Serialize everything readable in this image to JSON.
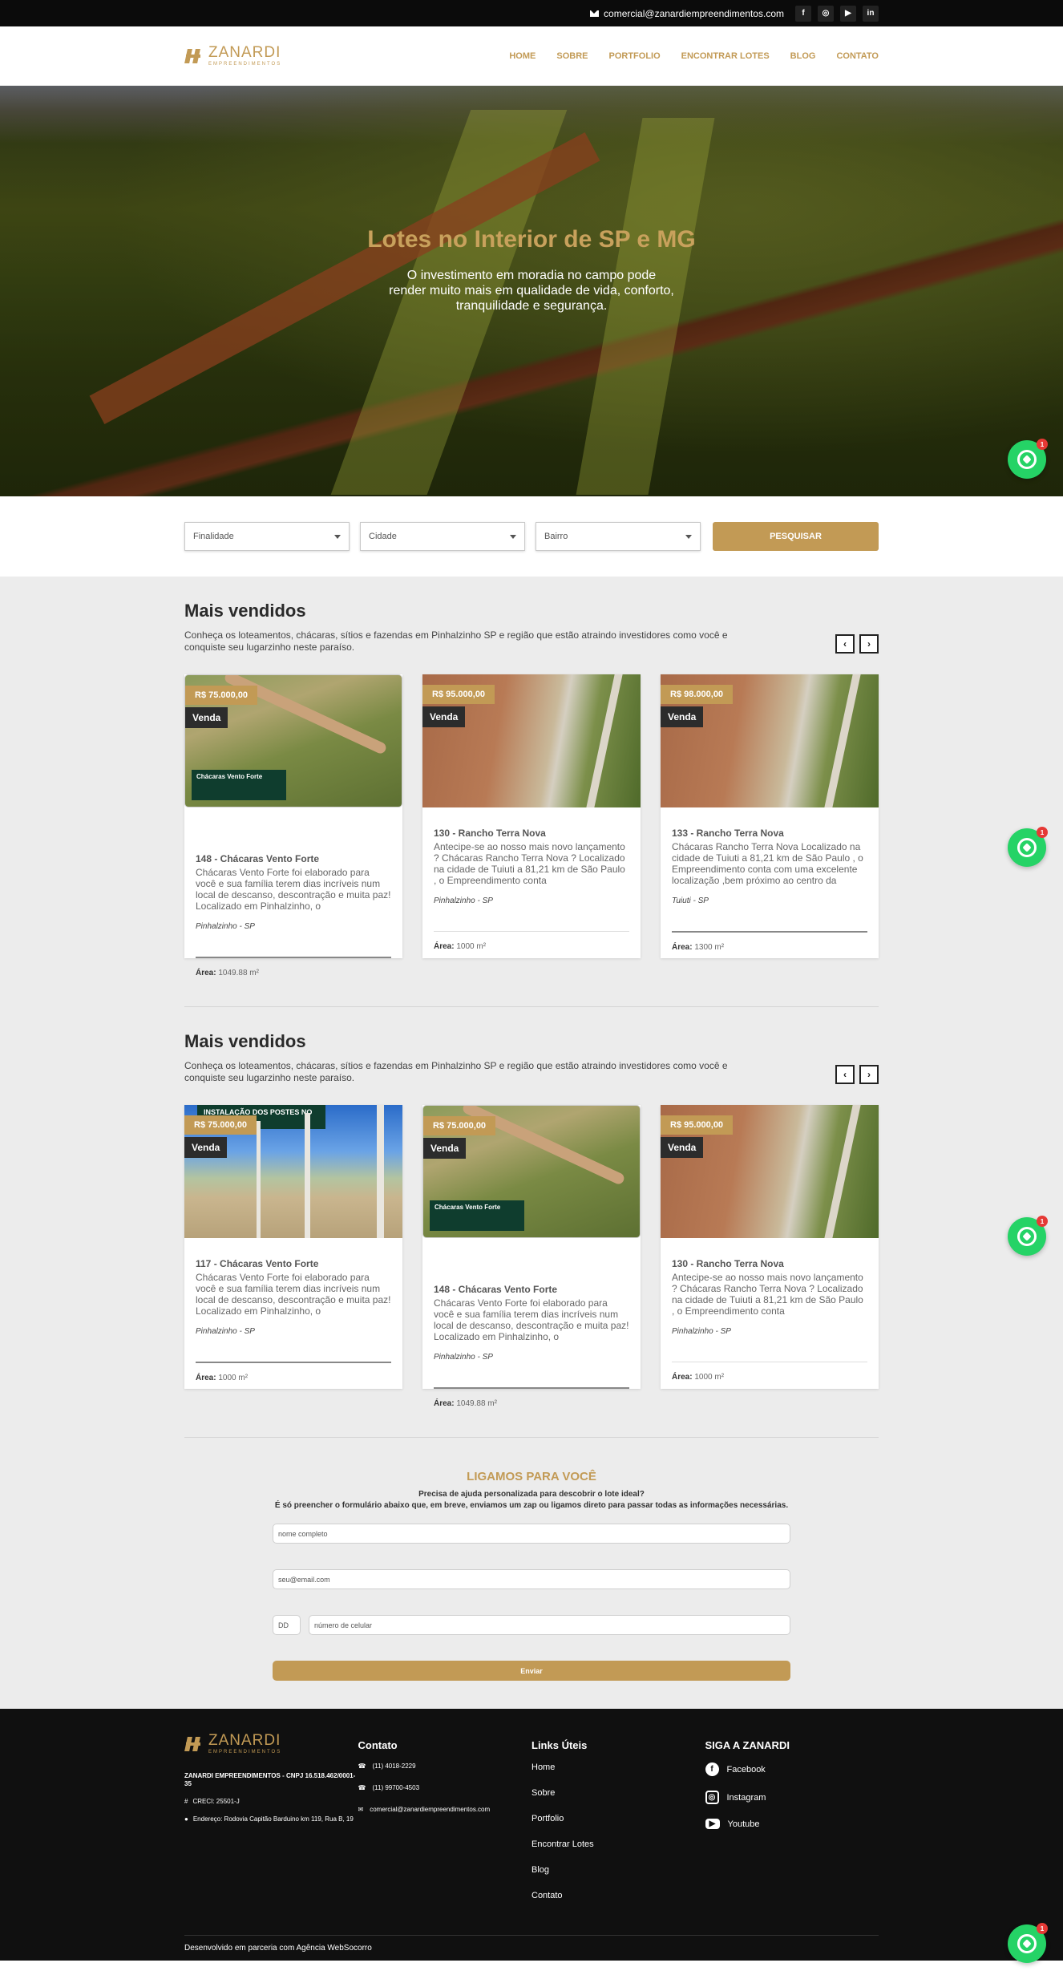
{
  "topbar": {
    "email": "comercial@zanardiempreendimentos.com",
    "social": [
      {
        "icon": "facebook-icon",
        "glyph": "f"
      },
      {
        "icon": "instagram-icon",
        "glyph": "◎"
      },
      {
        "icon": "youtube-icon",
        "glyph": "▶"
      },
      {
        "icon": "linkedin-icon",
        "glyph": "in"
      }
    ]
  },
  "header": {
    "brand": "ZANARDI",
    "brand_sub": "EMPREENDIMENTOS",
    "nav": [
      "HOME",
      "SOBRE",
      "PORTFOLIO",
      "ENCONTRAR LOTES",
      "BLOG",
      "CONTATO"
    ]
  },
  "hero": {
    "title": "Lotes no Interior de SP e MG",
    "subtitle": "O investimento em moradia no campo pode render muito mais em qualidade de vida, conforto, tranquilidade e segurança."
  },
  "search": {
    "finalidade": "Finalidade",
    "cidade": "Cidade",
    "bairro": "Bairro",
    "button": "PESQUISAR"
  },
  "sections": [
    {
      "title": "Mais vendidos",
      "desc": "Conheça os loteamentos, chácaras, sítios e fazendas em Pinhalzinho SP e região que estão atraindo investidores como você e conquiste seu lugarzinho neste paraíso.",
      "cards": [
        {
          "price": "R$ 75.000,00",
          "tag": "Venda",
          "title": "148 - Chácaras Vento Forte",
          "desc": "Chácaras Vento Forte foi elaborado para você e sua família terem dias incríveis num local de descanso, descontração e muita paz! Localizado em Pinhalzinho, o",
          "city": "Pinhalzinho - SP",
          "area_label": "Área:",
          "area": "1049.88 m²",
          "img": "field"
        },
        {
          "price": "R$ 95.000,00",
          "tag": "Venda",
          "title": "130 - Rancho Terra Nova",
          "desc": "Antecipe-se ao nosso mais novo lançamento ? Chácaras Rancho Terra Nova ? Localizado na cidade de Tuiuti a 81,21 km de São Paulo , o Empreendimento conta",
          "city": "Pinhalzinho - SP",
          "area_label": "Área:",
          "area": "1000 m²",
          "img": "road"
        },
        {
          "price": "R$ 98.000,00",
          "tag": "Venda",
          "title": "133 - Rancho Terra Nova",
          "desc": "Chácaras Rancho Terra Nova Localizado na cidade de Tuiuti a 81,21 km de São Paulo , o Empreendimento conta com uma excelente localização ,bem próximo ao centro da",
          "city": "Tuiuti - SP",
          "area_label": "Área:",
          "area": "1300 m²",
          "img": "road"
        }
      ]
    },
    {
      "title": "Mais vendidos",
      "desc": "Conheça os loteamentos, chácaras, sítios e fazendas em Pinhalzinho SP e região que estão atraindo investidores como você e conquiste seu lugarzinho neste paraíso.",
      "cards": [
        {
          "price": "R$ 75.000,00",
          "tag": "Venda",
          "title": "117 - Chácaras Vento Forte",
          "desc": "Chácaras Vento Forte foi elaborado para você e sua família terem dias incríveis num local de descanso, descontração e muita paz! Localizado em Pinhalzinho, o",
          "city": "Pinhalzinho - SP",
          "area_label": "Área:",
          "area": "1000 m²",
          "img": "install"
        },
        {
          "price": "R$ 75.000,00",
          "tag": "Venda",
          "title": "148 - Chácaras Vento Forte",
          "desc": "Chácaras Vento Forte foi elaborado para você e sua família terem dias incríveis num local de descanso, descontração e muita paz! Localizado em Pinhalzinho, o",
          "city": "Pinhalzinho - SP",
          "area_label": "Área:",
          "area": "1049.88 m²",
          "img": "field"
        },
        {
          "price": "R$ 95.000,00",
          "tag": "Venda",
          "title": "130 - Rancho Terra Nova",
          "desc": "Antecipe-se ao nosso mais novo lançamento ? Chácaras Rancho Terra Nova ? Localizado na cidade de Tuiuti a 81,21 km de São Paulo , o Empreendimento conta",
          "city": "Pinhalzinho - SP",
          "area_label": "Área:",
          "area": "1000 m²",
          "img": "road"
        }
      ]
    }
  ],
  "image_text": {
    "field_banner": "Chácaras Vento Forte",
    "install_banner": "INSTALAÇÃO DOS POSTES NO CHÁCARAS"
  },
  "contact": {
    "title": "LIGAMOS PARA VOCÊ",
    "sub1": "Precisa de ajuda personalizada para descobrir o lote ideal?",
    "sub2": "É só preencher o formulário abaixo que, em breve, enviamos um zap ou ligamos direto para passar todas as informações necessárias.",
    "name_placeholder": "nome completo",
    "email_placeholder": "seu@email.com",
    "ddd_placeholder": "DD",
    "phone_placeholder": "número de celular",
    "button": "Enviar"
  },
  "footer": {
    "company": "ZANARDI EMPREENDIMENTOS - CNPJ 16.518.462/0001-35",
    "creci": "CRECI: 25501-J",
    "address": "Endereço: Rodovia Capitão Barduino km 119, Rua B, 19",
    "contact_title": "Contato",
    "phone1": "(11) 4018-2229",
    "phone2": "(11) 99700-4503",
    "email": "comercial@zanardiempreendimentos.com",
    "links_title": "Links Úteis",
    "links": [
      "Home",
      "Sobre",
      "Portfolio",
      "Encontrar Lotes",
      "Blog",
      "Contato"
    ],
    "follow_title": "SIGA A ZANARDI",
    "social": [
      "Facebook",
      "Instagram",
      "Youtube"
    ],
    "credit": "Desenvolvido em parceria com Agência WebSocorro"
  },
  "whatsapp": {
    "badge": "1"
  },
  "colors": {
    "accent": "#c29a55",
    "dark": "#101010",
    "whatsapp": "#25d366"
  }
}
